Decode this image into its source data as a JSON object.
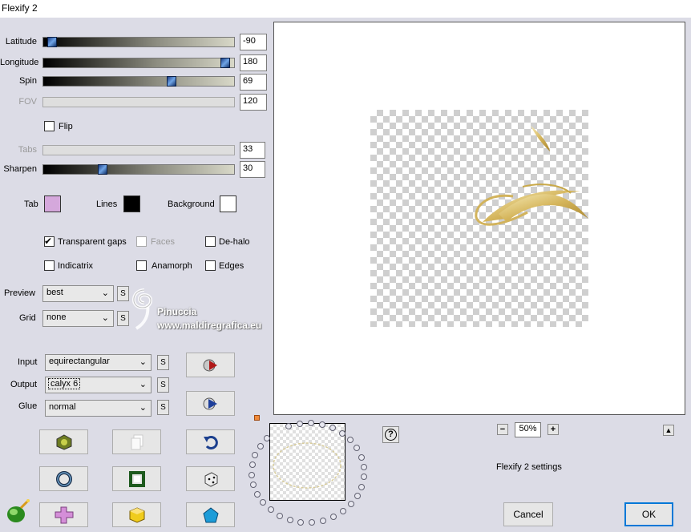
{
  "window": {
    "title": "Flexify 2"
  },
  "sliders": [
    {
      "label": "Latitude",
      "value": "-90",
      "level": 0.02,
      "disabled": false
    },
    {
      "label": "Longitude",
      "value": "180",
      "level": 0.98,
      "disabled": false
    },
    {
      "label": "Spin",
      "value": "69",
      "level": 0.68,
      "disabled": false
    },
    {
      "label": "FOV",
      "value": "120",
      "level": null,
      "disabled": true
    },
    {
      "label": "Tabs",
      "value": "33",
      "level": null,
      "disabled": true
    },
    {
      "label": "Sharpen",
      "value": "30",
      "level": 0.3,
      "disabled": false
    }
  ],
  "flip": {
    "label": "Flip",
    "checked": false
  },
  "colors": {
    "tab": {
      "label": "Tab",
      "color": "#d5a8dc"
    },
    "lines": {
      "label": "Lines",
      "color": "#000000"
    },
    "background": {
      "label": "Background",
      "color": "#ffffff"
    }
  },
  "checkboxes": {
    "transparent_gaps": {
      "label": "Transparent gaps",
      "checked": true
    },
    "faces": {
      "label": "Faces",
      "checked": false,
      "disabled": true
    },
    "de_halo": {
      "label": "De-halo",
      "checked": false
    },
    "indicatrix": {
      "label": "Indicatrix",
      "checked": false
    },
    "anamorph": {
      "label": "Anamorph",
      "checked": false
    },
    "edges": {
      "label": "Edges",
      "checked": false
    }
  },
  "preview": {
    "label": "Preview",
    "value": "best"
  },
  "grid": {
    "label": "Grid",
    "value": "none"
  },
  "input": {
    "label": "Input",
    "value": "equirectangular"
  },
  "output": {
    "label": "Output",
    "value": "calyx 6"
  },
  "glue": {
    "label": "Glue",
    "value": "normal"
  },
  "s_label": "S",
  "watermark": {
    "line1": "Pinuccia",
    "line2": "www.maldiregrafica.eu"
  },
  "zoom": {
    "minus": "−",
    "value": "50%",
    "plus": "+"
  },
  "help_label": "?",
  "settings_name": "Flexify 2 settings",
  "collapse_label": "▲",
  "buttons": {
    "cancel": "Cancel",
    "ok": "OK"
  }
}
